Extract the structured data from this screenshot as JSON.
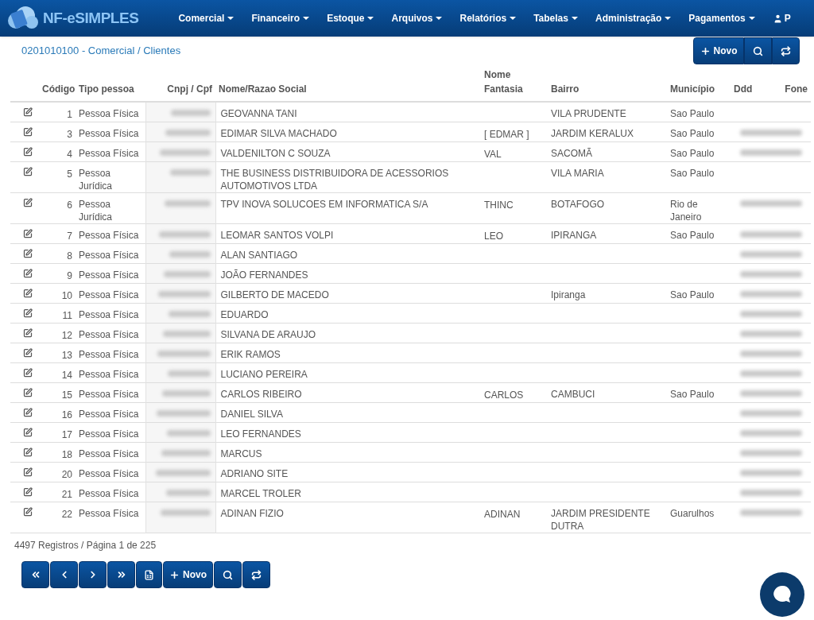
{
  "brand": "NF-eSIMPLES",
  "menu": [
    {
      "label": "Comercial"
    },
    {
      "label": "Financeiro"
    },
    {
      "label": "Estoque"
    },
    {
      "label": "Arquivos"
    },
    {
      "label": "Relatórios"
    },
    {
      "label": "Tabelas"
    },
    {
      "label": "Administração"
    },
    {
      "label": "Pagamentos"
    }
  ],
  "user": "P",
  "breadcrumb": "0201010100 - Comercial / Clientes",
  "top_actions": {
    "new_label": "Novo"
  },
  "table": {
    "columns": [
      "Código",
      "Tipo pessoa",
      "Cnpj / Cpf",
      "Nome/Razao Social",
      "Nome Fantasia",
      "Bairro",
      "Município",
      "Ddd",
      "Fone"
    ],
    "rows": [
      {
        "code": "1",
        "type": "Pessoa Física",
        "name": "GEOVANNA TANI",
        "fantasy": "",
        "district": "VILA PRUDENTE",
        "city": "Sao Paulo",
        "fone_blurred": false
      },
      {
        "code": "3",
        "type": "Pessoa Física",
        "name": "EDIMAR SILVA MACHADO",
        "fantasy": "[ EDMAR ]",
        "district": "JARDIM KERALUX",
        "city": "Sao Paulo",
        "fone_blurred": true
      },
      {
        "code": "4",
        "type": "Pessoa Física",
        "name": "VALDENILTON C SOUZA",
        "fantasy": "VAL",
        "district": "SACOMÃ",
        "city": "Sao Paulo",
        "fone_blurred": true
      },
      {
        "code": "5",
        "type": "Pessoa Jurídica",
        "name": "THE BUSINESS DISTRIBUIDORA DE ACESSORIOS AUTOMOTIVOS LTDA",
        "fantasy": "",
        "district": "VILA MARIA",
        "city": "Sao Paulo",
        "fone_blurred": false
      },
      {
        "code": "6",
        "type": "Pessoa Jurídica",
        "name": "TPV INOVA SOLUCOES EM INFORMATICA S/A",
        "fantasy": "THINC",
        "district": "BOTAFOGO",
        "city": "Rio de Janeiro",
        "fone_blurred": true
      },
      {
        "code": "7",
        "type": "Pessoa Física",
        "name": "LEOMAR SANTOS VOLPI",
        "fantasy": "LEO",
        "district": "IPIRANGA",
        "city": "Sao Paulo",
        "fone_blurred": true
      },
      {
        "code": "8",
        "type": "Pessoa Física",
        "name": "ALAN SANTIAGO",
        "fantasy": "",
        "district": "",
        "city": "",
        "fone_blurred": true
      },
      {
        "code": "9",
        "type": "Pessoa Física",
        "name": "JOÃO FERNANDES",
        "fantasy": "",
        "district": "",
        "city": "",
        "fone_blurred": true
      },
      {
        "code": "10",
        "type": "Pessoa Física",
        "name": "GILBERTO DE MACEDO",
        "fantasy": "",
        "district": "Ipiranga",
        "city": "Sao Paulo",
        "fone_blurred": true
      },
      {
        "code": "11",
        "type": "Pessoa Física",
        "name": "EDUARDO",
        "fantasy": "",
        "district": "",
        "city": "",
        "fone_blurred": true
      },
      {
        "code": "12",
        "type": "Pessoa Física",
        "name": "SILVANA DE ARAUJO",
        "fantasy": "",
        "district": "",
        "city": "",
        "fone_blurred": true
      },
      {
        "code": "13",
        "type": "Pessoa Física",
        "name": "ERIK RAMOS",
        "fantasy": "",
        "district": "",
        "city": "",
        "fone_blurred": true
      },
      {
        "code": "14",
        "type": "Pessoa Física",
        "name": "LUCIANO PEREIRA",
        "fantasy": "",
        "district": "",
        "city": "",
        "fone_blurred": true
      },
      {
        "code": "15",
        "type": "Pessoa Física",
        "name": "CARLOS RIBEIRO",
        "fantasy": "CARLOS",
        "district": "CAMBUCI",
        "city": "Sao Paulo",
        "fone_blurred": true
      },
      {
        "code": "16",
        "type": "Pessoa Física",
        "name": "DANIEL SILVA",
        "fantasy": "",
        "district": "",
        "city": "",
        "fone_blurred": true
      },
      {
        "code": "17",
        "type": "Pessoa Física",
        "name": "LEO FERNANDES",
        "fantasy": "",
        "district": "",
        "city": "",
        "fone_blurred": true
      },
      {
        "code": "18",
        "type": "Pessoa Física",
        "name": "MARCUS",
        "fantasy": "",
        "district": "",
        "city": "",
        "fone_blurred": true
      },
      {
        "code": "20",
        "type": "Pessoa Física",
        "name": "ADRIANO SITE",
        "fantasy": "",
        "district": "",
        "city": "",
        "fone_blurred": true
      },
      {
        "code": "21",
        "type": "Pessoa Física",
        "name": "MARCEL TROLER",
        "fantasy": "",
        "district": "",
        "city": "",
        "fone_blurred": true
      },
      {
        "code": "22",
        "type": "Pessoa Física",
        "name": "ADINAN FIZIO",
        "fantasy": "ADINAN",
        "district": "JARDIM PRESIDENTE DUTRA",
        "city": "Guarulhos",
        "fone_blurred": true
      }
    ]
  },
  "footer": {
    "summary": "4497 Registros / Página 1 de 225",
    "new_label": "Novo"
  }
}
